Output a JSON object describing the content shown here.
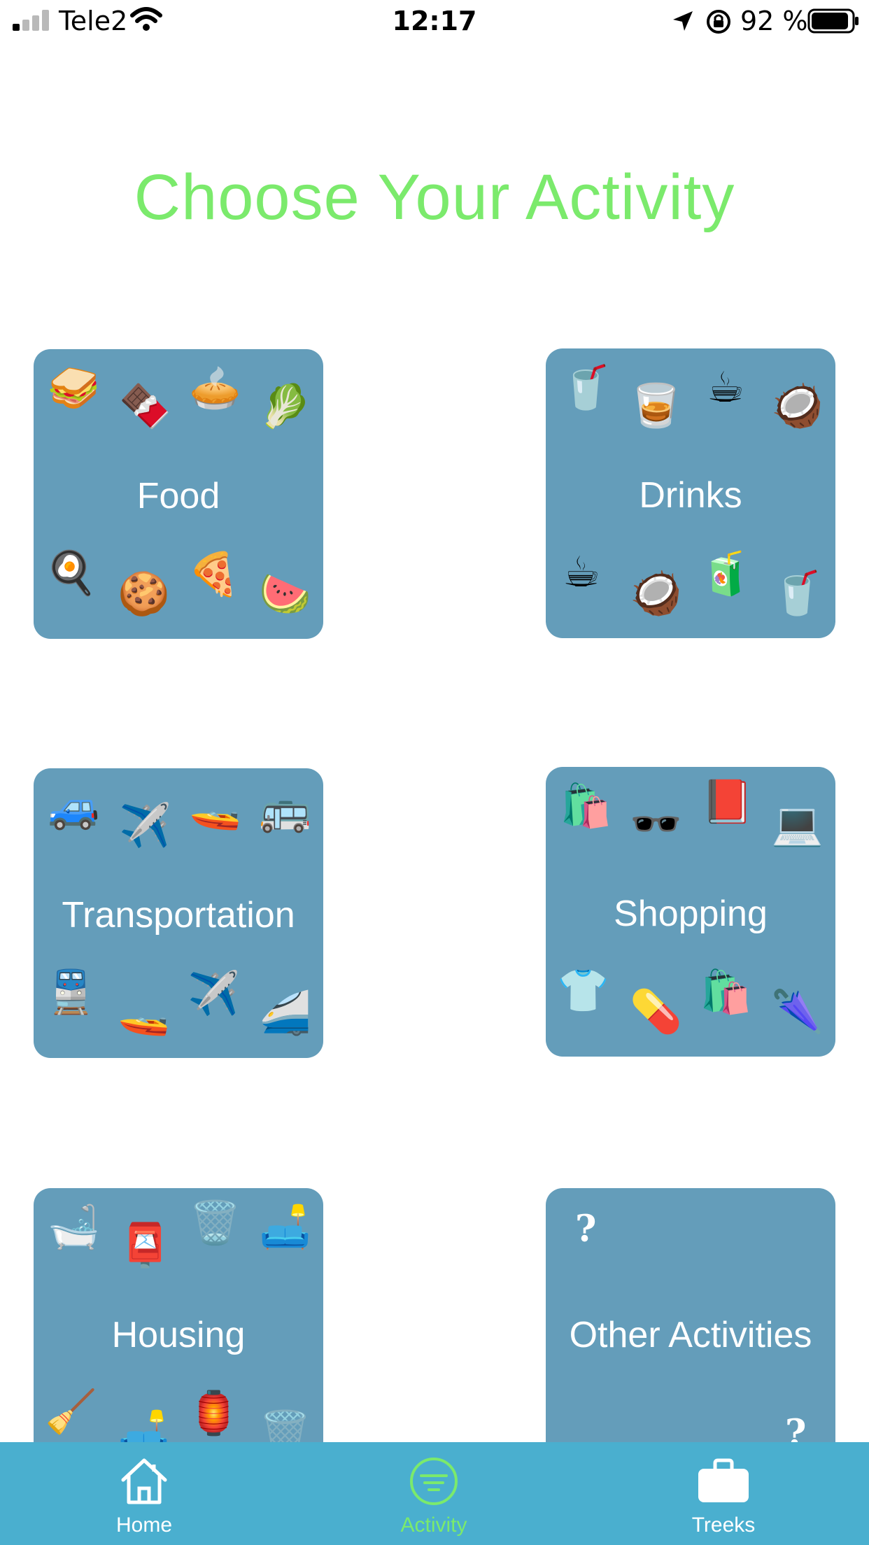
{
  "status_bar": {
    "carrier": "Tele2",
    "time": "12:17",
    "battery_percent": "92 %",
    "signal_bars": 2,
    "battery_level": 0.92
  },
  "title": "Choose Your Activity",
  "colors": {
    "title": "#7bea6c",
    "tile": "#649dba",
    "tab_bar": "#4aafcf",
    "active_tab": "#7bea6c"
  },
  "tiles": [
    {
      "label": "Food",
      "emoji_top": [
        "🥪",
        "🍫",
        "🥧",
        "🥬"
      ],
      "emoji_bottom": [
        "🍳",
        "🍪",
        "🍕",
        "🍉"
      ]
    },
    {
      "label": "Drinks",
      "emoji_top": [
        "🥤",
        "🥃",
        "☕",
        "🥥"
      ],
      "emoji_bottom": [
        "☕",
        "🥥",
        "🧃",
        "🥤"
      ]
    },
    {
      "label": "Transportation",
      "emoji_top": [
        "🚙",
        "✈️",
        "🚤",
        "🚌"
      ],
      "emoji_bottom": [
        "🚆",
        "🚤",
        "✈️",
        "🚄"
      ]
    },
    {
      "label": "Shopping",
      "emoji_top": [
        "🛍️",
        "🕶️",
        "📕",
        "💻"
      ],
      "emoji_bottom": [
        "👕",
        "💊",
        "🛍️",
        "🌂"
      ]
    },
    {
      "label": "Housing",
      "emoji_top": [
        "🛁",
        "📮",
        "🗑️",
        "🛋️"
      ],
      "emoji_bottom": [
        "🧹",
        "🛋️",
        "🏮",
        "🗑️"
      ]
    },
    {
      "label": "Other Activities",
      "marks": [
        "?",
        "?"
      ]
    }
  ],
  "tabs": [
    {
      "label": "Home",
      "icon": "home-icon",
      "active": false
    },
    {
      "label": "Activity",
      "icon": "list-circle-icon",
      "active": true
    },
    {
      "label": "Treeks",
      "icon": "briefcase-icon",
      "active": false
    }
  ]
}
